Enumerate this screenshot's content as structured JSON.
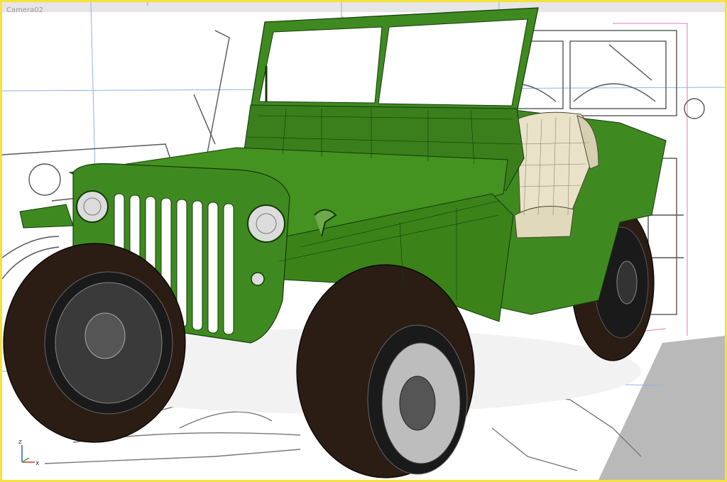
{
  "viewport": {
    "camera_label": "Camera02",
    "active_border_color": "#f6e23a"
  },
  "axis_gizmo": {
    "z_label": "z",
    "x_label": "x",
    "icon": "axis-tripod-icon"
  },
  "colors": {
    "body_green": "#3f8a20",
    "body_dark": "#2c6a14",
    "wire": "#123a08",
    "tire": "#2b1d14",
    "seat": "#e9e2c8",
    "blueprint_line": "#555555",
    "grid_blue": "#8fb3e6",
    "bbox_pink": "#e07ab8"
  }
}
